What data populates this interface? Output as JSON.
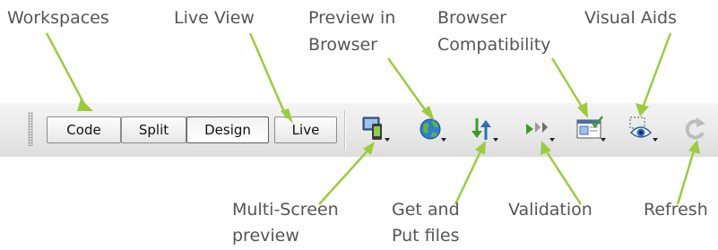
{
  "labels_top": {
    "workspaces": "Workspaces",
    "live_view": "Live View",
    "preview_line1": "Preview in",
    "preview_line2": "Browser",
    "compat_line1": "Browser",
    "compat_line2": "Compatibility",
    "visual_aids": "Visual Aids"
  },
  "labels_bottom": {
    "multiscreen_line1": "Multi-Screen",
    "multiscreen_line2": "preview",
    "getput_line1": "Get and",
    "getput_line2": "Put files",
    "validation": "Validation",
    "refresh": "Refresh"
  },
  "toolbar": {
    "code": "Code",
    "split": "Split",
    "design": "Design",
    "live": "Live",
    "selected": "Design"
  },
  "icons": [
    "multi-screen-icon",
    "globe-icon",
    "get-put-arrows-icon",
    "validation-icon",
    "browser-compatibility-icon",
    "visual-aids-eye-icon",
    "refresh-icon"
  ],
  "colors": {
    "callout_line": "#9ccc3c",
    "label_text": "#555555"
  }
}
